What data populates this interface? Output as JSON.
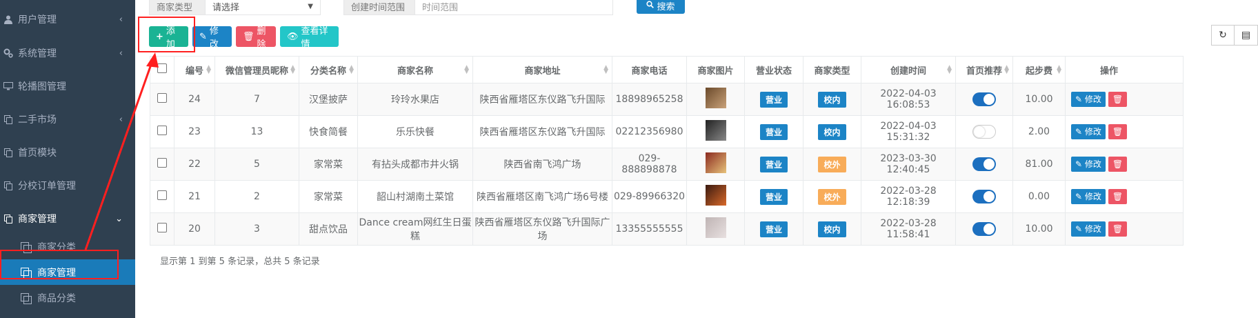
{
  "sidebar": {
    "items": [
      {
        "label": "用户管理",
        "icon": "user-icon",
        "chevron": "‹"
      },
      {
        "label": "系统管理",
        "icon": "gears-icon",
        "chevron": "‹"
      },
      {
        "label": "轮播图管理",
        "icon": "monitor-icon",
        "chevron": ""
      },
      {
        "label": "二手市场",
        "icon": "copy-icon",
        "chevron": "‹"
      },
      {
        "label": "首页模块",
        "icon": "copy-icon",
        "chevron": ""
      },
      {
        "label": "分校订单管理",
        "icon": "copy-icon",
        "chevron": ""
      },
      {
        "label": "商家管理",
        "icon": "copy-icon",
        "chevron": "⌄"
      }
    ],
    "subitems": [
      {
        "label": "商家分类"
      },
      {
        "label": "商家管理"
      },
      {
        "label": "商品分类"
      }
    ]
  },
  "search": {
    "type_label": "商家类型",
    "type_value": "请选择",
    "time_label": "创建时间范围",
    "time_placeholder": "时间范围",
    "search_button": "搜索"
  },
  "toolbar": {
    "add": "添加",
    "edit": "修改",
    "delete": "删除",
    "detail": "查看详情"
  },
  "table": {
    "headers": [
      "编号",
      "微信管理员昵称",
      "分类名称",
      "商家名称",
      "商家地址",
      "商家电话",
      "商家图片",
      "营业状态",
      "商家类型",
      "创建时间",
      "首页推荐",
      "起步费",
      "操作"
    ],
    "rows": [
      {
        "id": "24",
        "nickname": "7",
        "category": "汉堡披萨",
        "name": "玲玲水果店",
        "address": "陕西省雁塔区东仪路飞升国际",
        "phone": "18898965258",
        "status": "营业",
        "type": "校内",
        "type_color": "#1c84c6",
        "created": "2022-04-03 16:08:53",
        "recommend": true,
        "fee": "10.00",
        "edit": "修改"
      },
      {
        "id": "23",
        "nickname": "13",
        "category": "快食简餐",
        "name": "乐乐快餐",
        "address": "陕西省雁塔区东仪路飞升国际",
        "phone": "02212356980",
        "status": "营业",
        "type": "校内",
        "type_color": "#1c84c6",
        "created": "2022-04-03 15:31:32",
        "recommend": false,
        "fee": "2.00",
        "edit": "修改"
      },
      {
        "id": "22",
        "nickname": "5",
        "category": "家常菜",
        "name": "有拈头成都市井火锅",
        "address": "陕西省南飞鸿广场",
        "phone": "029-888898878",
        "status": "营业",
        "type": "校外",
        "type_color": "#f8ac59",
        "created": "2023-03-30 12:40:45",
        "recommend": true,
        "fee": "81.00",
        "edit": "修改"
      },
      {
        "id": "21",
        "nickname": "2",
        "category": "家常菜",
        "name": "韶山村湖南土菜馆",
        "address": "陕西省雁塔区南飞鸿广场6号楼",
        "phone": "029-89966320",
        "status": "营业",
        "type": "校外",
        "type_color": "#f8ac59",
        "created": "2022-03-28 12:18:39",
        "recommend": true,
        "fee": "0.00",
        "edit": "修改"
      },
      {
        "id": "20",
        "nickname": "3",
        "category": "甜点饮品",
        "name": "Dance cream网红生日蛋糕",
        "address": "陕西省雁塔区东仪路飞升国际广场",
        "phone": "13355555555",
        "status": "营业",
        "type": "校内",
        "type_color": "#1c84c6",
        "created": "2022-03-28 11:58:41",
        "recommend": true,
        "fee": "10.00",
        "edit": "修改"
      }
    ]
  },
  "footer": {
    "summary": "显示第 1 到第 5 条记录，总共 5 条记录"
  },
  "colors": {
    "sidebar_bg": "#2f4050",
    "active_blue": "#1a7bb9",
    "add_green": "#1ab394",
    "delete_red": "#ed5565",
    "detail_cyan": "#23c6c8",
    "annotation_red": "#ff1f1f"
  }
}
